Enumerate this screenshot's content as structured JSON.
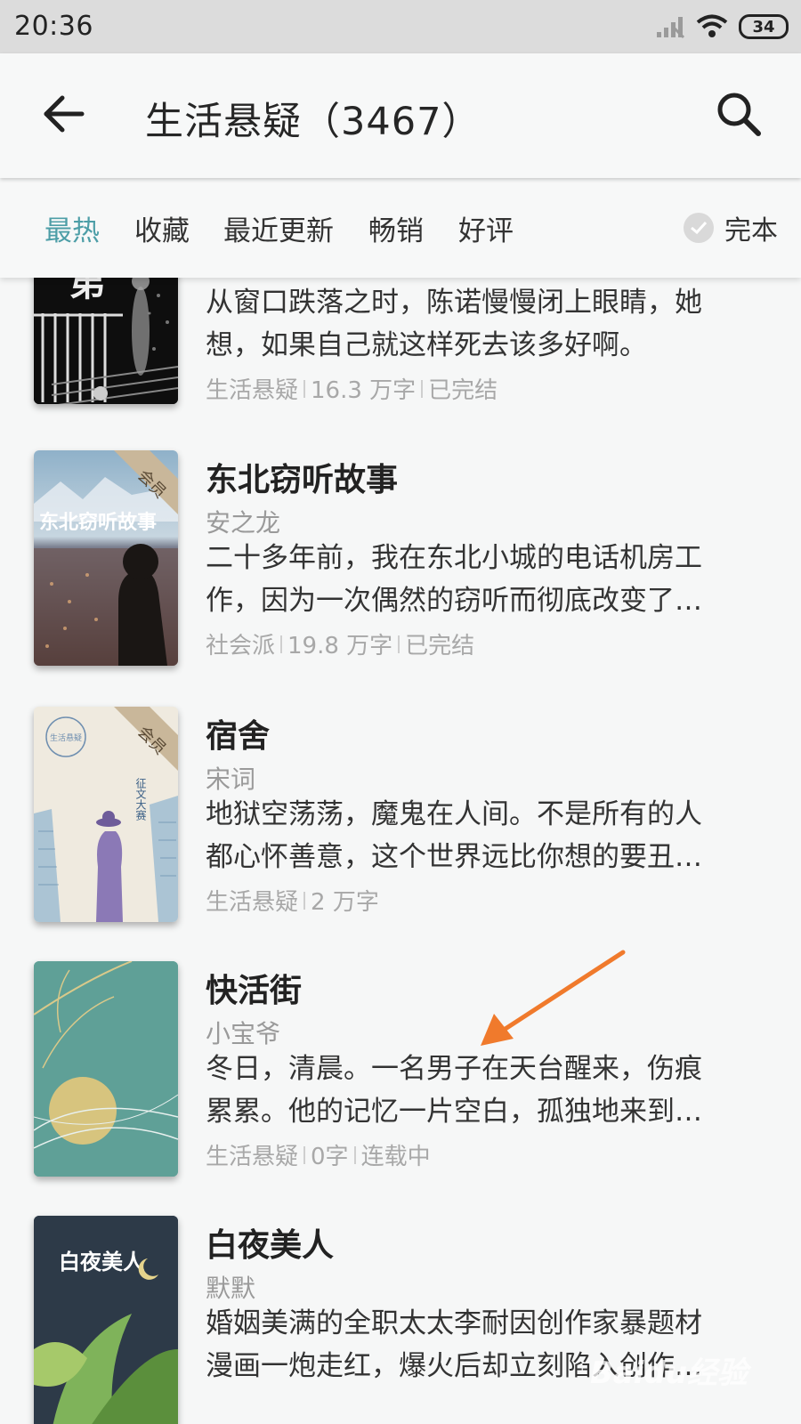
{
  "status_bar": {
    "time": "20:36",
    "battery": "34"
  },
  "header": {
    "title": "生活悬疑（3467）"
  },
  "filters": {
    "tabs": [
      {
        "label": "最热",
        "active": true
      },
      {
        "label": "收藏"
      },
      {
        "label": "最近更新"
      },
      {
        "label": "畅销"
      },
      {
        "label": "好评"
      }
    ],
    "complete_label": "完本"
  },
  "books": [
    {
      "desc_lines": [
        "从窗口跌落之时，陈诺慢慢闭上眼睛，她",
        "想，如果自己就这样死去该多好啊。"
      ],
      "meta": [
        "生活悬疑",
        "16.3 万字",
        "已完结"
      ],
      "cover_text": "弟"
    },
    {
      "title": "东北窃听故事",
      "author": "安之龙",
      "desc_lines": [
        "二十多年前，我在东北小城的电话机房工",
        "作，因为一次偶然的窃听而彻底改变了…"
      ],
      "meta": [
        "社会派",
        "19.8 万字",
        "已完结"
      ],
      "ribbon": "会员",
      "cover_text": "东北窃听故事"
    },
    {
      "title": "宿舍",
      "author": "宋词",
      "desc_lines": [
        "地狱空荡荡，魔鬼在人间。不是所有的人",
        "都心怀善意，这个世界远比你想的要丑…"
      ],
      "meta": [
        "生活悬疑",
        "2 万字"
      ],
      "ribbon": "会员",
      "cover_text": "生活悬疑",
      "cover_text2": "第",
      "cover_text3": "征文大赛"
    },
    {
      "title": "快活街",
      "author": "小宝爷",
      "desc_lines": [
        "冬日，清晨。一名男子在天台醒来，伤痕",
        "累累。他的记忆一片空白，孤独地来到…"
      ],
      "meta": [
        "生活悬疑",
        "0字",
        "连载中"
      ]
    },
    {
      "title": "白夜美人",
      "author": "默默",
      "desc_lines": [
        "婚姻美满的全职太太李耐因创作家暴题材",
        "漫画一炮走红，爆火后却立刻陷入创作…"
      ],
      "cover_text": "白夜美人"
    }
  ],
  "watermark": "Baidu经验"
}
